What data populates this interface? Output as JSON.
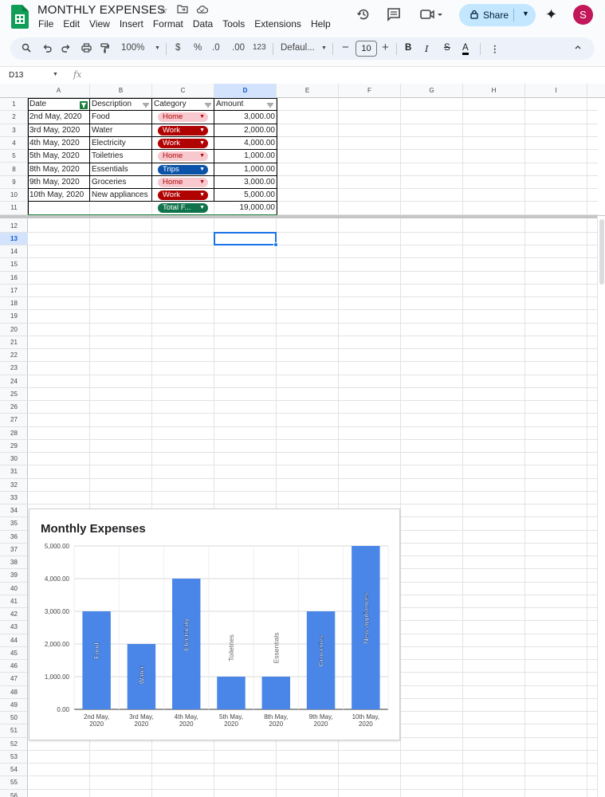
{
  "app": {
    "title": "MONTHLY EXPENSES",
    "menus": [
      "File",
      "Edit",
      "View",
      "Insert",
      "Format",
      "Data",
      "Tools",
      "Extensions",
      "Help"
    ],
    "share_label": "Share",
    "avatar_letter": "S"
  },
  "toolbar": {
    "zoom": "100%",
    "currency": "$",
    "percent": "%",
    "dec_decrease": ".0",
    "dec_increase": ".00",
    "number_format": "123",
    "font": "Defaul...",
    "font_size": "10",
    "bold": "B",
    "italic": "I",
    "strike": "S",
    "text_color": "A"
  },
  "formula_bar": {
    "name_box": "D13",
    "fx": "fx",
    "content": ""
  },
  "columns": [
    "A",
    "B",
    "C",
    "D",
    "E",
    "F",
    "G",
    "H",
    "I"
  ],
  "active_column": "D",
  "active_row": "13",
  "rows": [
    "1",
    "2",
    "3",
    "4",
    "5",
    "8",
    "9",
    "10",
    "11",
    "12",
    "13",
    "14",
    "15",
    "16",
    "17",
    "18",
    "19",
    "20",
    "21",
    "22",
    "23",
    "24",
    "25",
    "26",
    "27",
    "28",
    "29",
    "30",
    "31",
    "32",
    "33",
    "34",
    "35",
    "36",
    "37",
    "38",
    "39",
    "40",
    "41",
    "42",
    "43",
    "44",
    "45",
    "46",
    "47",
    "48",
    "49",
    "50",
    "51",
    "52",
    "53",
    "54",
    "55",
    "56"
  ],
  "table": {
    "headers": [
      "Date",
      "Description",
      "Category",
      "Amount"
    ],
    "rows": [
      {
        "date": "2nd May, 2020",
        "description": "Food",
        "category": "Home",
        "amount": "3,000.00"
      },
      {
        "date": "3rd May, 2020",
        "description": "Water",
        "category": "Work",
        "amount": "2,000.00"
      },
      {
        "date": "4th May, 2020",
        "description": "Electricity",
        "category": "Work",
        "amount": "4,000.00"
      },
      {
        "date": "5th May, 2020",
        "description": "Toiletries",
        "category": "Home",
        "amount": "1,000.00"
      },
      {
        "date": "8th May, 2020",
        "description": "Essentials",
        "category": "Trips",
        "amount": "1,000.00"
      },
      {
        "date": "9th May, 2020",
        "description": "Groceries",
        "category": "Home",
        "amount": "3,000.00"
      },
      {
        "date": "10th May, 2020",
        "description": "New appliances",
        "category": "Work",
        "amount": "5,000.00"
      }
    ],
    "total": {
      "category": "Total F...",
      "amount": "19,000.00"
    }
  },
  "category_colors": {
    "Home": {
      "bg": "#f7c9cf",
      "fg": "#b10202"
    },
    "Work": {
      "bg": "#b10202",
      "fg": "#ffffff"
    },
    "Trips": {
      "bg": "#0a53a8",
      "fg": "#ffffff"
    },
    "Total F...": {
      "bg": "#11734b",
      "fg": "#ffffff"
    }
  },
  "chart_data": {
    "type": "bar",
    "title": "Monthly Expenses",
    "categories": [
      "2nd May, 2020",
      "3rd May, 2020",
      "4th May, 2020",
      "5th May, 2020",
      "8th May, 2020",
      "9th May, 2020",
      "10th May, 2020"
    ],
    "category_lines": [
      [
        "2nd May,",
        "2020"
      ],
      [
        "3rd May,",
        "2020"
      ],
      [
        "4th May,",
        "2020"
      ],
      [
        "5th May,",
        "2020"
      ],
      [
        "8th May,",
        "2020"
      ],
      [
        "9th May,",
        "2020"
      ],
      [
        "10th May,",
        "2020"
      ]
    ],
    "values": [
      3000,
      2000,
      4000,
      1000,
      1000,
      3000,
      5000
    ],
    "bar_labels": [
      "Food",
      "Water",
      "Electricity",
      "Toiletries",
      "Essentials",
      "Groceries",
      "New appliances"
    ],
    "ylim": [
      0,
      5000
    ],
    "yticks": [
      "0.00",
      "1,000.00",
      "2,000.00",
      "3,000.00",
      "4,000.00",
      "5,000.00"
    ],
    "grid": true,
    "bar_color": "#4a86e8"
  }
}
